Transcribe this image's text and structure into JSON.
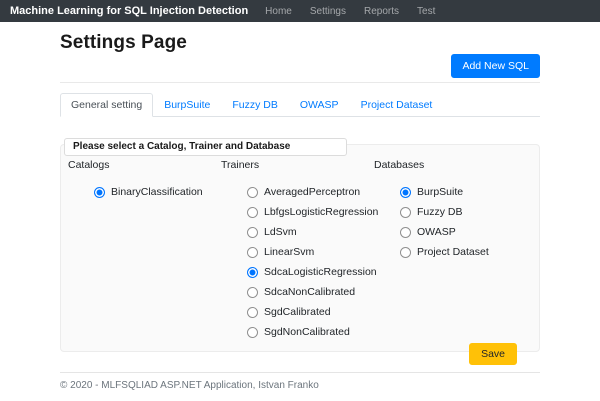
{
  "navbar": {
    "brand": "Machine Learning for SQL Injection Detection",
    "links": [
      {
        "label": "Home"
      },
      {
        "label": "Settings"
      },
      {
        "label": "Reports"
      },
      {
        "label": "Test"
      }
    ]
  },
  "page": {
    "title": "Settings Page",
    "add_button_label": "Add New SQL"
  },
  "tabs": [
    {
      "label": "General setting",
      "active": true
    },
    {
      "label": "BurpSuite"
    },
    {
      "label": "Fuzzy DB"
    },
    {
      "label": "OWASP"
    },
    {
      "label": "Project Dataset"
    }
  ],
  "panel": {
    "legend": "Please select a Catalog, Trainer and Database",
    "catalogs": {
      "header": "Catalogs",
      "options": [
        {
          "label": "BinaryClassification",
          "selected": true
        }
      ]
    },
    "trainers": {
      "header": "Trainers",
      "options": [
        {
          "label": "AveragedPerceptron"
        },
        {
          "label": "LbfgsLogisticRegression"
        },
        {
          "label": "LdSvm"
        },
        {
          "label": "LinearSvm"
        },
        {
          "label": "SdcaLogisticRegression",
          "selected": true
        },
        {
          "label": "SdcaNonCalibrated"
        },
        {
          "label": "SgdCalibrated"
        },
        {
          "label": "SgdNonCalibrated"
        }
      ]
    },
    "databases": {
      "header": "Databases",
      "options": [
        {
          "label": "BurpSuite",
          "selected": true
        },
        {
          "label": "Fuzzy DB"
        },
        {
          "label": "OWASP"
        },
        {
          "label": "Project Dataset"
        }
      ]
    },
    "save_button_label": "Save"
  },
  "footer": {
    "text": "© 2020 - MLFSQLIAD ASP.NET Application, Istvan Franko"
  },
  "colors": {
    "navbar_bg": "#343a40",
    "primary": "#007bff",
    "warning": "#ffc107",
    "radio_selected": "#0075ff",
    "panel_bg": "#fafafa",
    "muted_text": "#6c757d"
  }
}
